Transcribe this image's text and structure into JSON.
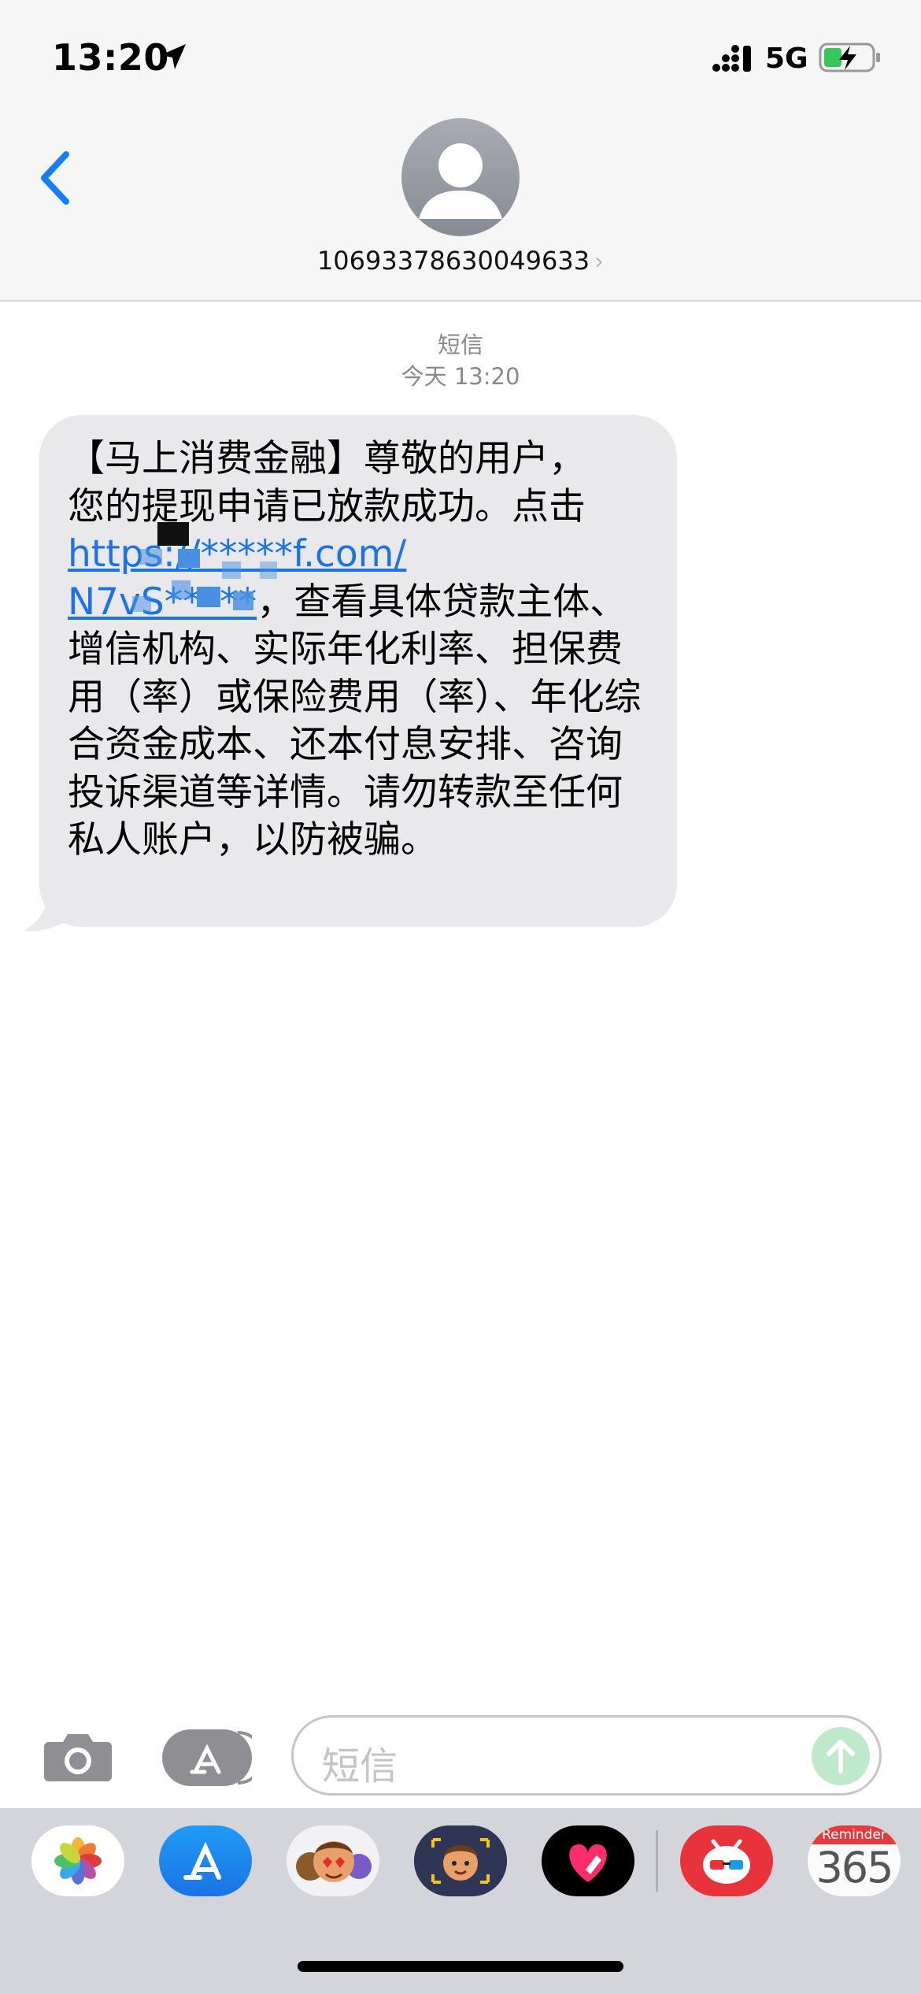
{
  "status_bar": {
    "time": "13:20",
    "network": "5G"
  },
  "header": {
    "contact_number": "10693378630049633",
    "chevron": "›"
  },
  "conversation": {
    "service_label": "短信",
    "timestamp_day": "今天",
    "timestamp_time": "13:20",
    "message": {
      "line1": "【马上消费金融】尊敬的用户，",
      "line2": "您的提现申请已放款成功。点击",
      "link_line1": "https://*****f.com/",
      "link_line2": "N7vS*****",
      "text_after_link": "，查看具体贷款主体、增信机构、实际年化利率、担保费用（率）或保险费用（率）、年化综合资金成本、还本付息安排、咨询投诉渠道等详情。请勿转款至任何私人账户，以防被骗。"
    }
  },
  "composer": {
    "placeholder": "短信"
  },
  "app_drawer": {
    "apps": [
      {
        "name": "photos-app-icon"
      },
      {
        "name": "app-store-app-icon"
      },
      {
        "name": "memoji-stickers-app-icon"
      },
      {
        "name": "memoji-app-icon"
      },
      {
        "name": "digital-touch-app-icon"
      },
      {
        "name": "fun-app-icon"
      },
      {
        "name": "reminder-365-app-icon"
      }
    ],
    "reminder_label": "Reminder",
    "reminder_number": "365"
  },
  "colors": {
    "link": "#1a73e8",
    "bubble": "#e9e9eb",
    "ios_blue": "#147efb",
    "send_button": "#bfe9cb"
  }
}
